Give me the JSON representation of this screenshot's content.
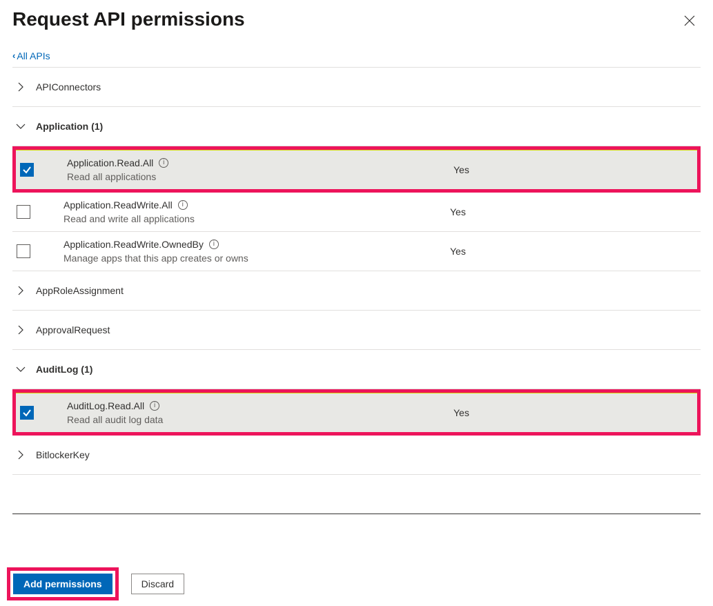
{
  "title": "Request API permissions",
  "back_link": "All APIs",
  "groups": [
    {
      "name": "APIConnectors",
      "expanded": false,
      "count": null,
      "items": []
    },
    {
      "name": "Application",
      "expanded": true,
      "count": 1,
      "items": [
        {
          "name": "Application.Read.All",
          "desc": "Read all applications",
          "admin": "Yes",
          "checked": true,
          "highlighted": true
        },
        {
          "name": "Application.ReadWrite.All",
          "desc": "Read and write all applications",
          "admin": "Yes",
          "checked": false,
          "highlighted": false
        },
        {
          "name": "Application.ReadWrite.OwnedBy",
          "desc": "Manage apps that this app creates or owns",
          "admin": "Yes",
          "checked": false,
          "highlighted": false
        }
      ]
    },
    {
      "name": "AppRoleAssignment",
      "expanded": false,
      "count": null,
      "items": []
    },
    {
      "name": "ApprovalRequest",
      "expanded": false,
      "count": null,
      "items": []
    },
    {
      "name": "AuditLog",
      "expanded": true,
      "count": 1,
      "items": [
        {
          "name": "AuditLog.Read.All",
          "desc": "Read all audit log data",
          "admin": "Yes",
          "checked": true,
          "highlighted": true
        }
      ]
    },
    {
      "name": "BitlockerKey",
      "expanded": false,
      "count": null,
      "items": []
    }
  ],
  "buttons": {
    "add": "Add permissions",
    "discard": "Discard"
  }
}
